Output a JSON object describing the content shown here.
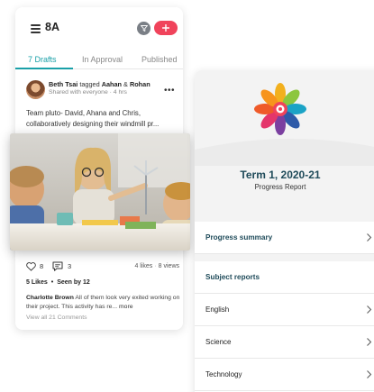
{
  "feed": {
    "class_name": "8A",
    "tabs": [
      {
        "label": "7 Drafts",
        "active": true
      },
      {
        "label": "In Approval",
        "active": false
      },
      {
        "label": "Published",
        "active": false
      }
    ],
    "post": {
      "author": "Beth Tsai",
      "tagged_text": "tagged",
      "tagged_1": "Aahan",
      "amp": "&",
      "tagged_2": "Rohan",
      "meta": "Shared with everyone · 4 hrs",
      "text": "Team pluto- David, Ahana and Chris, collaboratively designing their windmill pr...",
      "like_count": "8",
      "comment_count": "3",
      "likes_views_a": "4 likes",
      "likes_views_sep": "·",
      "likes_views_b": "8 views",
      "likes_summary": "5 Likes",
      "seen_summary": "Seen by 12",
      "seen_sep": "•",
      "comment_author": "Charlotte Brown",
      "comment_text": "All of them look very exited working on their project. This activity has re...",
      "comment_more": "more",
      "view_comments": "View all 21 Comments"
    }
  },
  "report": {
    "title": "Term 1, 2020-21",
    "subtitle": "Progress Report",
    "progress_summary": "Progress summary",
    "subject_reports": "Subject reports",
    "subjects": [
      "English",
      "Science",
      "Technology"
    ]
  },
  "colors": {
    "accent": "#1aa0a8",
    "add_button": "#f0435b",
    "report_title": "#1f4b5a"
  },
  "icons": [
    "hamburger-icon",
    "filter-icon",
    "plus-icon",
    "more-icon",
    "heart-icon",
    "comment-icon",
    "chevron-right-icon",
    "school-logo"
  ]
}
